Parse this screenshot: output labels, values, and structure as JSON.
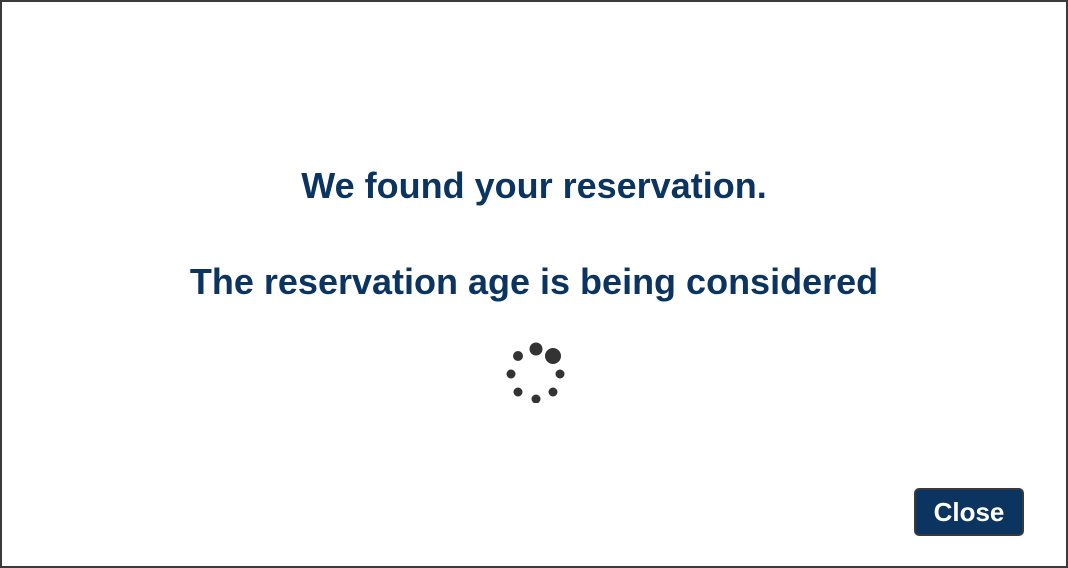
{
  "dialog": {
    "message_primary": "We found your reservation.",
    "message_secondary": "The reservation age is being considered",
    "close_label": "Close"
  },
  "colors": {
    "heading_text": "#0b3460",
    "button_background": "#0b3460",
    "button_text": "#ffffff",
    "spinner_dots": "#333333",
    "border": "#3a3a3a"
  },
  "icons": {
    "spinner": "loading-spinner-icon"
  }
}
